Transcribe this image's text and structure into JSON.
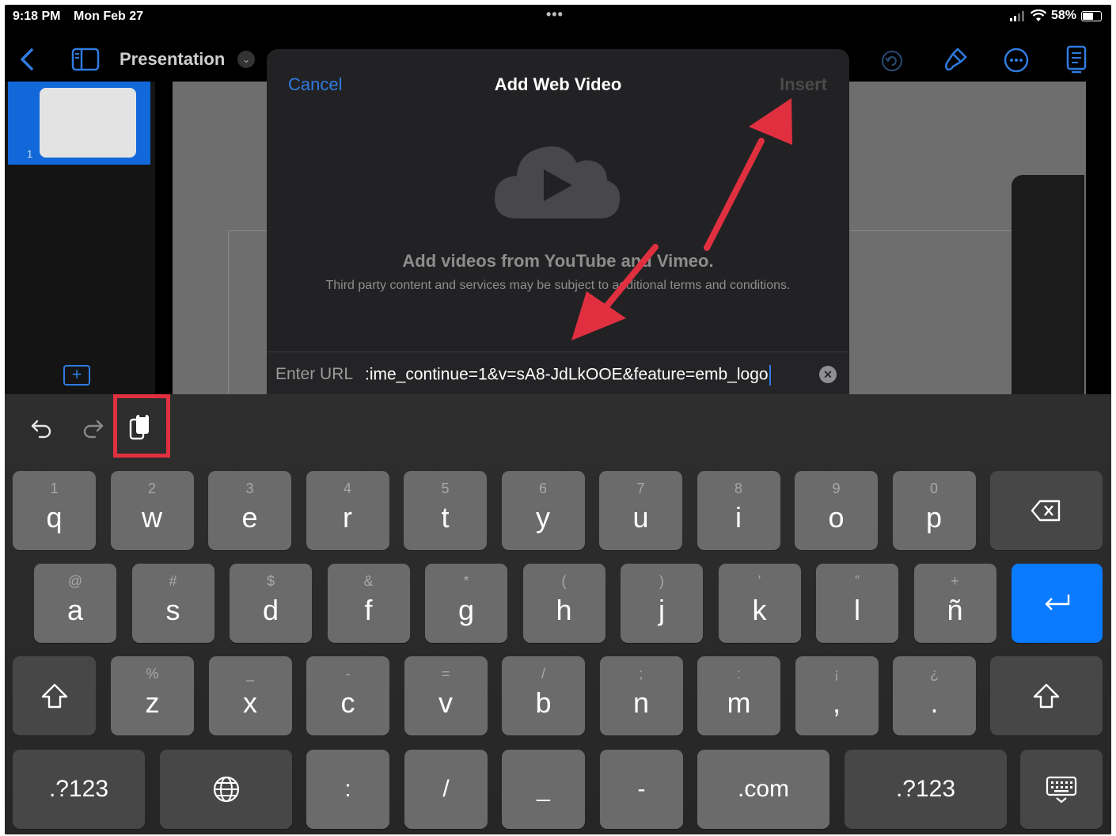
{
  "status_bar": {
    "time": "9:18 PM",
    "date": "Mon Feb 27",
    "dots": "•••",
    "battery": "58%",
    "battery_level": 0.58
  },
  "toolbar": {
    "doc_title": "Presentation"
  },
  "navigator": {
    "slide_number": "1"
  },
  "dialog": {
    "cancel": "Cancel",
    "title": "Add Web Video",
    "insert": "Insert",
    "heading": "Add videos from YouTube and Vimeo.",
    "subtext": "Third party content and services may be subject to additional terms and conditions.",
    "url_label": "Enter URL",
    "url_value": ":ime_continue=1&v=sA8-JdLkOOE&feature=emb_logo",
    "clear_glyph": "✕"
  },
  "keyboard": {
    "row1": [
      {
        "hint": "1",
        "key": "q"
      },
      {
        "hint": "2",
        "key": "w"
      },
      {
        "hint": "3",
        "key": "e"
      },
      {
        "hint": "4",
        "key": "r"
      },
      {
        "hint": "5",
        "key": "t"
      },
      {
        "hint": "6",
        "key": "y"
      },
      {
        "hint": "7",
        "key": "u"
      },
      {
        "hint": "8",
        "key": "i"
      },
      {
        "hint": "9",
        "key": "o"
      },
      {
        "hint": "0",
        "key": "p"
      }
    ],
    "row2": [
      {
        "hint": "@",
        "key": "a"
      },
      {
        "hint": "#",
        "key": "s"
      },
      {
        "hint": "$",
        "key": "d"
      },
      {
        "hint": "&",
        "key": "f"
      },
      {
        "hint": "*",
        "key": "g"
      },
      {
        "hint": "(",
        "key": "h"
      },
      {
        "hint": ")",
        "key": "j"
      },
      {
        "hint": "’",
        "key": "k"
      },
      {
        "hint": "”",
        "key": "l"
      },
      {
        "hint": "+",
        "key": "ñ"
      }
    ],
    "row3": [
      {
        "hint": "%",
        "key": "z"
      },
      {
        "hint": "_",
        "key": "x"
      },
      {
        "hint": "-",
        "key": "c"
      },
      {
        "hint": "=",
        "key": "v"
      },
      {
        "hint": "/",
        "key": "b"
      },
      {
        "hint": ";",
        "key": "n"
      },
      {
        "hint": ":",
        "key": "m"
      },
      {
        "hint": "¡",
        "key": ","
      },
      {
        "hint": "¿",
        "key": "."
      }
    ],
    "row4": {
      "numbers_left": ".?123",
      "colon": ":",
      "slash": "/",
      "underscore": "_",
      "dash": "-",
      "dotcom": ".com",
      "numbers_right": ".?123"
    }
  },
  "colors": {
    "accent": "#0a7aff",
    "annotation": "#e03040"
  }
}
